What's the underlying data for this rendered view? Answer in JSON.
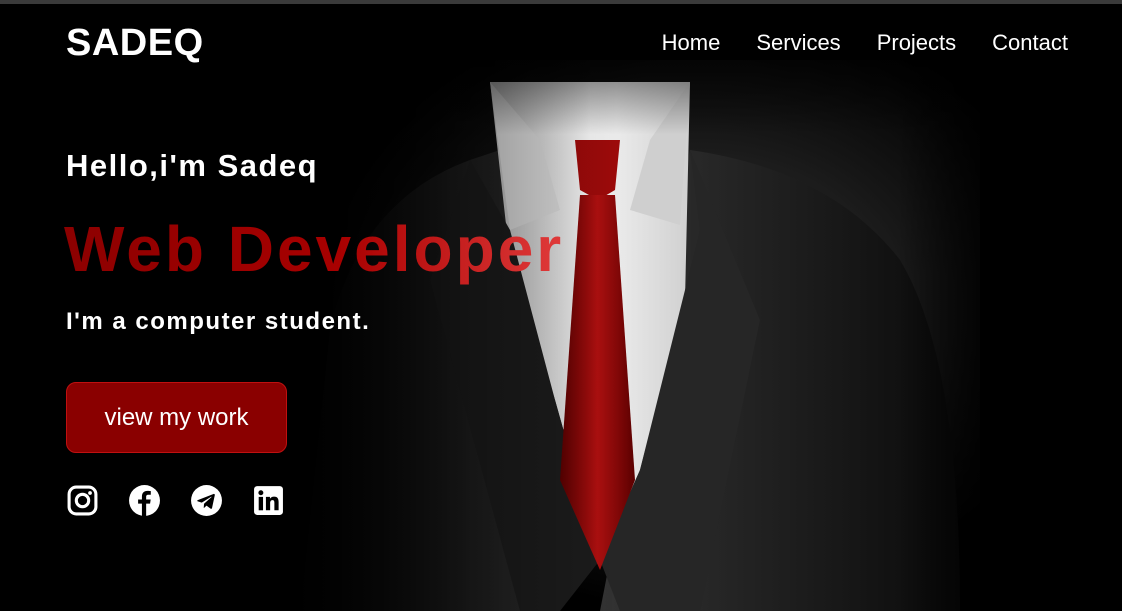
{
  "header": {
    "brand": "SADEQ",
    "nav": [
      "Home",
      "Services",
      "Projects",
      "Contact"
    ]
  },
  "hero": {
    "greeting": "Hello,i'm Sadeq",
    "role": "Web Developer",
    "tagline": "I'm a computer student.",
    "cta_label": "view my work"
  },
  "socials": [
    {
      "icon": "instagram-icon"
    },
    {
      "icon": "facebook-icon"
    },
    {
      "icon": "telegram-icon"
    },
    {
      "icon": "linkedin-icon"
    }
  ],
  "colors": {
    "background": "#000000",
    "accent": "#8a0000",
    "text": "#ffffff"
  }
}
